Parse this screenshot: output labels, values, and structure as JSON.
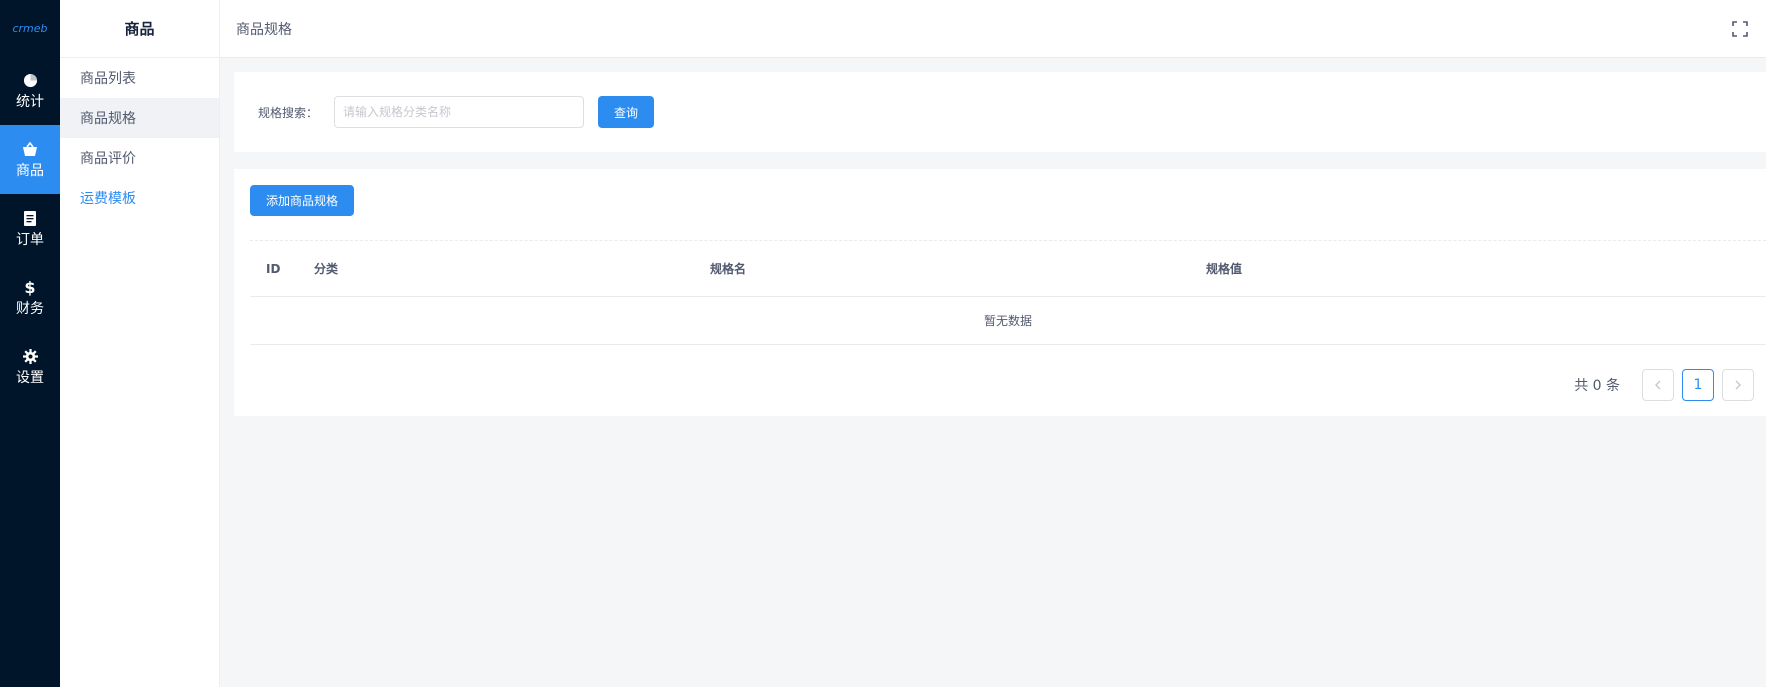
{
  "rail": {
    "logo": "crmeb",
    "items": [
      {
        "label": "统计",
        "icon": "pie-chart-icon"
      },
      {
        "label": "商品",
        "icon": "basket-icon"
      },
      {
        "label": "订单",
        "icon": "document-icon"
      },
      {
        "label": "财务",
        "icon": "dollar-icon"
      },
      {
        "label": "设置",
        "icon": "gear-icon"
      }
    ]
  },
  "subnav": {
    "title": "商品",
    "items": [
      {
        "label": "商品列表"
      },
      {
        "label": "商品规格"
      },
      {
        "label": "商品评价"
      },
      {
        "label": "运费模板"
      }
    ]
  },
  "header": {
    "breadcrumb": "商品规格",
    "fullscreen_icon": "fullscreen-icon"
  },
  "search": {
    "label": "规格搜索：",
    "placeholder": "请输入规格分类名称",
    "value": "",
    "query_button": "查询"
  },
  "table": {
    "add_button": "添加商品规格",
    "columns": [
      "ID",
      "分类",
      "规格名",
      "规格值"
    ],
    "empty_text": "暂无数据"
  },
  "pagination": {
    "total_text": "共 0 条",
    "current_page": "1"
  },
  "colors": {
    "primary": "#2d8cf0",
    "rail_bg": "#001529"
  }
}
